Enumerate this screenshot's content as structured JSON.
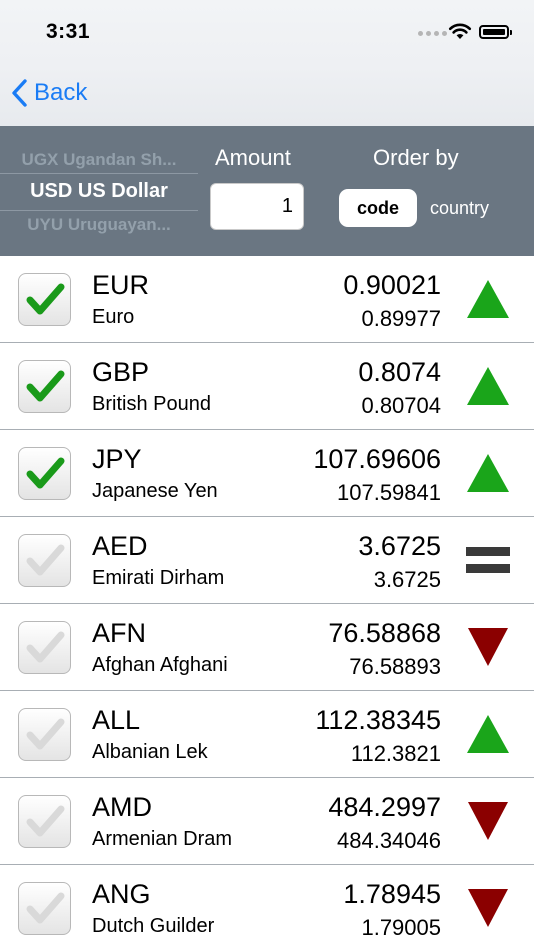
{
  "status_bar": {
    "time": "3:31"
  },
  "nav": {
    "back_label": "Back"
  },
  "picker": {
    "above": "UGX Ugandan Sh...",
    "selected": "USD US Dollar",
    "below": "UYU Uruguayan..."
  },
  "amount": {
    "label": "Amount",
    "value": "1"
  },
  "order_by": {
    "label": "Order by",
    "options": [
      "code",
      "country"
    ],
    "selected": "code"
  },
  "colors": {
    "up": "#1aa51a",
    "down": "#8b0000",
    "equal": "#3a3a3a",
    "check": "#1a9a1a",
    "check_off": "#d9d9d9",
    "back": "#1a7cf5"
  },
  "rates": [
    {
      "code": "EUR",
      "name": "Euro",
      "rate": "0.90021",
      "previous": "0.89977",
      "checked": true,
      "trend": "up"
    },
    {
      "code": "GBP",
      "name": "British Pound",
      "rate": "0.8074",
      "previous": "0.80704",
      "checked": true,
      "trend": "up"
    },
    {
      "code": "JPY",
      "name": "Japanese Yen",
      "rate": "107.69606",
      "previous": "107.59841",
      "checked": true,
      "trend": "up"
    },
    {
      "code": "AED",
      "name": "Emirati Dirham",
      "rate": "3.6725",
      "previous": "3.6725",
      "checked": false,
      "trend": "equal"
    },
    {
      "code": "AFN",
      "name": "Afghan Afghani",
      "rate": "76.58868",
      "previous": "76.58893",
      "checked": false,
      "trend": "down"
    },
    {
      "code": "ALL",
      "name": "Albanian Lek",
      "rate": "112.38345",
      "previous": "112.3821",
      "checked": false,
      "trend": "up"
    },
    {
      "code": "AMD",
      "name": "Armenian Dram",
      "rate": "484.2997",
      "previous": "484.34046",
      "checked": false,
      "trend": "down"
    },
    {
      "code": "ANG",
      "name": "Dutch Guilder",
      "rate": "1.78945",
      "previous": "1.79005",
      "checked": false,
      "trend": "down"
    }
  ]
}
